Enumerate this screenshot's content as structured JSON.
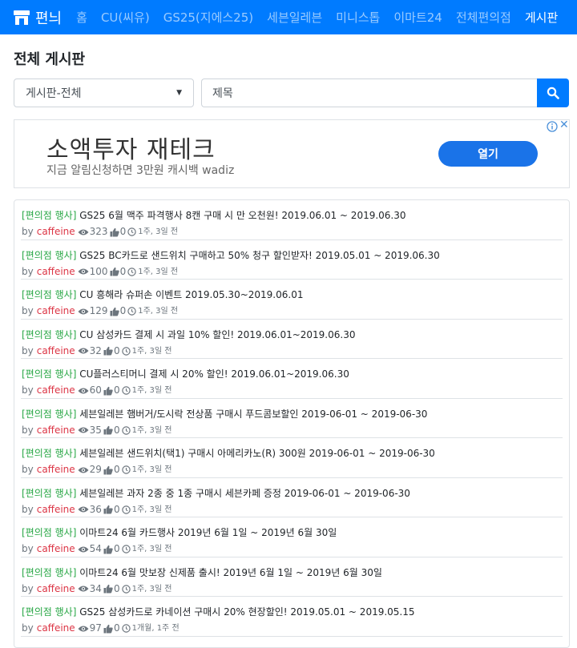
{
  "nav": {
    "brand": "편늬",
    "items": [
      "홈",
      "CU(씨유)",
      "GS25(지에스25)",
      "세븐일레븐",
      "미니스톱",
      "이마트24",
      "전체편의점",
      "게시판"
    ]
  },
  "page": {
    "title": "전체 게시판"
  },
  "search": {
    "select_value": "게시판-전체",
    "placeholder": "제목"
  },
  "ad": {
    "title": "소액투자 재테크",
    "subtitle": "지금 알림신청하면 3만원 캐시백 wadiz",
    "button": "열기"
  },
  "posts": [
    {
      "category": "[편의점 행사]",
      "title": "GS25 6월 맥주 파격행사 8캔 구매 시 만 오천원! 2019.06.01 ~ 2019.06.30",
      "by": "by",
      "author": "caffeine",
      "views": "323",
      "likes": "0",
      "time": "1주, 3일 전"
    },
    {
      "category": "[편의점 행사]",
      "title": "GS25 BC카드로 샌드위치 구매하고 50% 청구 할인받자! 2019.05.01 ~ 2019.06.30",
      "by": "by",
      "author": "caffeine",
      "views": "100",
      "likes": "0",
      "time": "1주, 3일 전"
    },
    {
      "category": "[편의점 행사]",
      "title": "CU 흥해라 슈퍼손 이벤트 2019.05.30~2019.06.01",
      "by": "by",
      "author": "caffeine",
      "views": "129",
      "likes": "0",
      "time": "1주, 3일 전"
    },
    {
      "category": "[편의점 행사]",
      "title": "CU 삼성카드 결제 시 과일 10% 할인! 2019.06.01~2019.06.30",
      "by": "by",
      "author": "caffeine",
      "views": "32",
      "likes": "0",
      "time": "1주, 3일 전"
    },
    {
      "category": "[편의점 행사]",
      "title": "CU플러스티머니 결제 시 20% 할인! 2019.06.01~2019.06.30",
      "by": "by",
      "author": "caffeine",
      "views": "60",
      "likes": "0",
      "time": "1주, 3일 전"
    },
    {
      "category": "[편의점 행사]",
      "title": "세븐일레븐 햄버거/도시락 전상품 구매시 푸드콤보할인 2019-06-01 ~ 2019-06-30",
      "by": "by",
      "author": "caffeine",
      "views": "35",
      "likes": "0",
      "time": "1주, 3일 전"
    },
    {
      "category": "[편의점 행사]",
      "title": "세븐일레븐 샌드위치(택1) 구매시 아메리카노(R) 300원 2019-06-01 ~ 2019-06-30",
      "by": "by",
      "author": "caffeine",
      "views": "29",
      "likes": "0",
      "time": "1주, 3일 전"
    },
    {
      "category": "[편의점 행사]",
      "title": "세븐일레븐 과자 2종 중 1종 구매시 세븐카페 증정 2019-06-01 ~ 2019-06-30",
      "by": "by",
      "author": "caffeine",
      "views": "36",
      "likes": "0",
      "time": "1주, 3일 전"
    },
    {
      "category": "[편의점 행사]",
      "title": "이마트24 6월 카드행사 2019년 6월 1일 ~ 2019년 6월 30일",
      "by": "by",
      "author": "caffeine",
      "views": "54",
      "likes": "0",
      "time": "1주, 3일 전"
    },
    {
      "category": "[편의점 행사]",
      "title": "이마트24 6월 맛보장 신제품 출시! 2019년 6월 1일 ~ 2019년 6월 30일",
      "by": "by",
      "author": "caffeine",
      "views": "34",
      "likes": "0",
      "time": "1주, 3일 전"
    },
    {
      "category": "[편의점 행사]",
      "title": "GS25 삼성카드로 카네이션 구매시 20% 현장할인! 2019.05.01 ~ 2019.05.15",
      "by": "by",
      "author": "caffeine",
      "views": "97",
      "likes": "0",
      "time": "1개월, 1주 전"
    }
  ],
  "colors": {
    "primary": "#007bff",
    "category": "#28a745",
    "author": "#dc3545",
    "ad_button": "#1a73e8"
  }
}
